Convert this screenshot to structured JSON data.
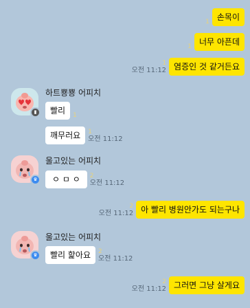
{
  "colors": {
    "background": "#b2c7da",
    "my_bubble": "#fee500",
    "their_bubble": "#ffffff",
    "unread": "#e8d27b"
  },
  "messages": [
    {
      "side": "out",
      "text": "손목이",
      "unread": "1",
      "time": ""
    },
    {
      "side": "out",
      "text": "너무 아픈데",
      "unread": "1",
      "time": ""
    },
    {
      "side": "out",
      "text": "염증인 것 같거든요",
      "unread": "1",
      "time": "오전 11:12"
    },
    {
      "side": "in",
      "sender": "하트뿅뿅 어피치",
      "avatar": "heart-eyes-peach-icon",
      "text": "빨리",
      "unread": "1",
      "time": ""
    },
    {
      "side": "in",
      "text": "깨무러요",
      "unread": "1",
      "time": "오전 11:12"
    },
    {
      "side": "in",
      "sender": "울고있는 어피치",
      "avatar": "crying-peach-icon",
      "text": "ㅇ ㅁ ㅇ",
      "unread": "2",
      "time": "오전 11:12"
    },
    {
      "side": "out",
      "text": "아 빨리 병원안가도 되는구나",
      "unread": "2",
      "time": "오전 11:12"
    },
    {
      "side": "in",
      "sender": "울고있는 어피치",
      "avatar": "crying-peach-icon",
      "text": "빨리 핥아요",
      "unread": "2",
      "time": "오전 11:12"
    },
    {
      "side": "out",
      "text": "그러면 그냥 살게요",
      "unread": "2",
      "time": "오전 11:12"
    }
  ]
}
